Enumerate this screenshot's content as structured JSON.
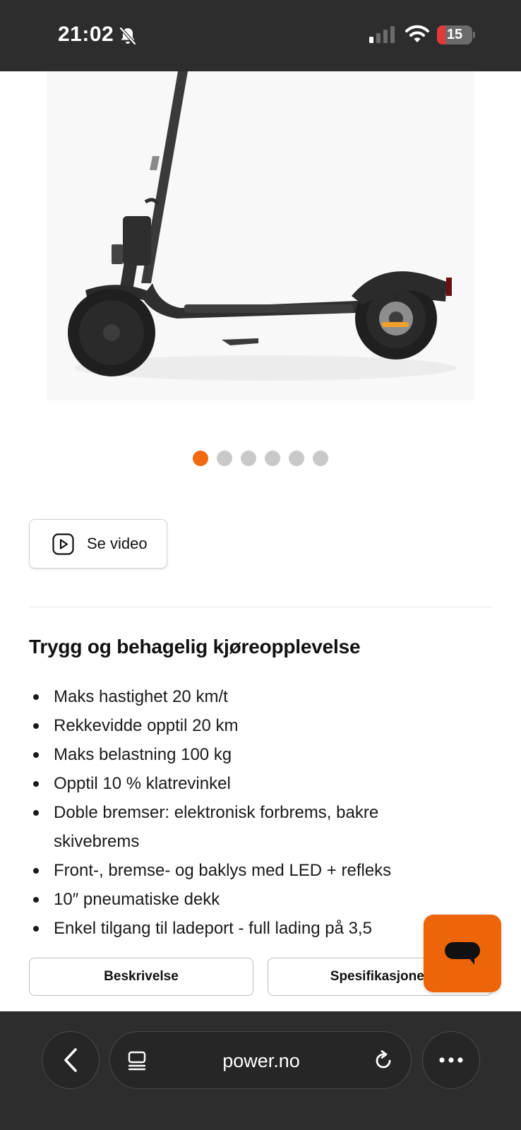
{
  "status_bar": {
    "time": "21:02",
    "battery": "15",
    "battery_level": 0.15,
    "battery_color": "#e5383b",
    "icons": [
      "bell-slash-icon",
      "cellular-signal-icon",
      "wifi-icon",
      "battery-icon"
    ]
  },
  "product": {
    "image_icon": "electric-scooter-image"
  },
  "carousel": {
    "count": 6,
    "active_index": 0,
    "active_color": "#ef6a10",
    "inactive_color": "#c9c9c9"
  },
  "video_button": {
    "label": "Se video",
    "icon": "play-icon"
  },
  "section": {
    "heading": "Trygg og behagelig kjøreopplevelse",
    "features": [
      "Maks hastighet 20 km/t",
      "Rekkevidde opptil 20 km",
      "Maks belastning 100 kg",
      "Opptil 10 % klatrevinkel",
      "Doble bremser: elektronisk forbrems, bakre skivebrems",
      "Front-, bremse- og baklys med LED + refleks",
      "10″ pneumatiske dekk",
      "Enkel tilgang til ladeport - full lading på 3,5"
    ]
  },
  "tabs": {
    "description": "Beskrivelse",
    "specifications": "Spesifikasjoner"
  },
  "chat": {
    "icon": "chat-bubble-icon",
    "color": "#ec6508"
  },
  "browser": {
    "url": "power.no",
    "icons": [
      "chevron-left-icon",
      "tabs-icon",
      "reload-icon",
      "more-icon"
    ]
  }
}
